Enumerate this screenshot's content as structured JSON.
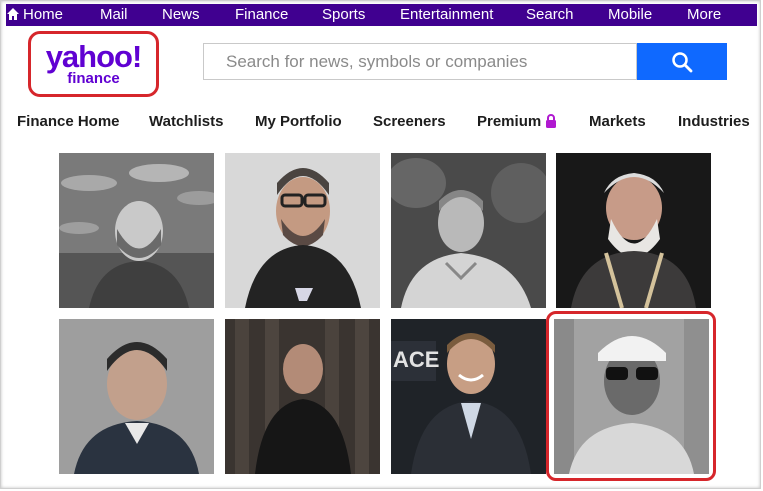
{
  "topnav": {
    "items": [
      "Home",
      "Mail",
      "News",
      "Finance",
      "Sports",
      "Entertainment",
      "Search",
      "Mobile",
      "More"
    ]
  },
  "logo": {
    "main": "yahoo!",
    "sub": "finance"
  },
  "search": {
    "placeholder": "Search for news, symbols or companies"
  },
  "subnav": {
    "items": [
      "Finance Home",
      "Watchlists",
      "My Portfolio",
      "Screeners",
      "Premium",
      "Markets",
      "Industries"
    ]
  },
  "photos": [
    "Portrait of bald man with stubble smiling",
    "Portrait of man with glasses and beard in suit",
    "Portrait of man in light jacket outdoors",
    "Portrait of older man with white beard and lanyard",
    "Portrait of man with short dark hair in suit",
    "Portrait of man in dark shirt against wooden wall",
    "Portrait of smiling man in suit",
    "Portrait of man wearing cap and sunglasses"
  ],
  "colors": {
    "topbar": "#400090",
    "brand": "#6001d2",
    "search_button": "#0f69ff",
    "highlight": "#d6262b"
  }
}
